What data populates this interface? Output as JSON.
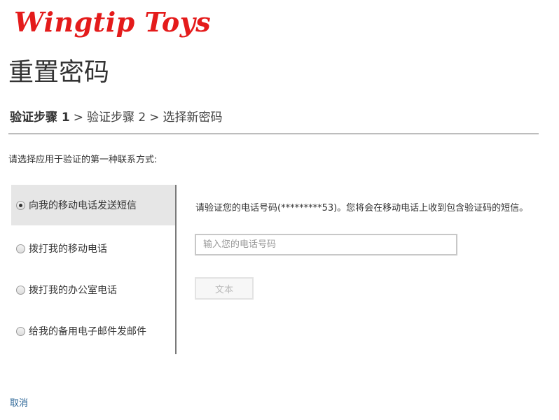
{
  "header": {
    "logo_text": "Wingtip Toys",
    "page_title": "重置密码"
  },
  "steps": {
    "step1": "验证步骤 1",
    "separator": ">",
    "step2": "验证步骤 2",
    "step3": "选择新密码"
  },
  "prompt": "请选择应用于验证的第一种联系方式:",
  "options": [
    {
      "label": "向我的移动电话发送短信",
      "selected": true
    },
    {
      "label": "拨打我的移动电话",
      "selected": false
    },
    {
      "label": "拨打我的办公室电话",
      "selected": false
    },
    {
      "label": "给我的备用电子邮件发邮件",
      "selected": false
    }
  ],
  "detail": {
    "instruction": "请验证您的电话号码(*********53)。您将会在移动电话上收到包含验证码的短信。",
    "phone_placeholder": "输入您的电话号码",
    "phone_value": "",
    "send_button_label": "文本"
  },
  "footer": {
    "cancel_label": "取消"
  },
  "colors": {
    "logo": "#e41b1b",
    "selected_option_bg": "#e6e6e6",
    "link": "#2a6496",
    "rule": "#bdbdbd"
  }
}
